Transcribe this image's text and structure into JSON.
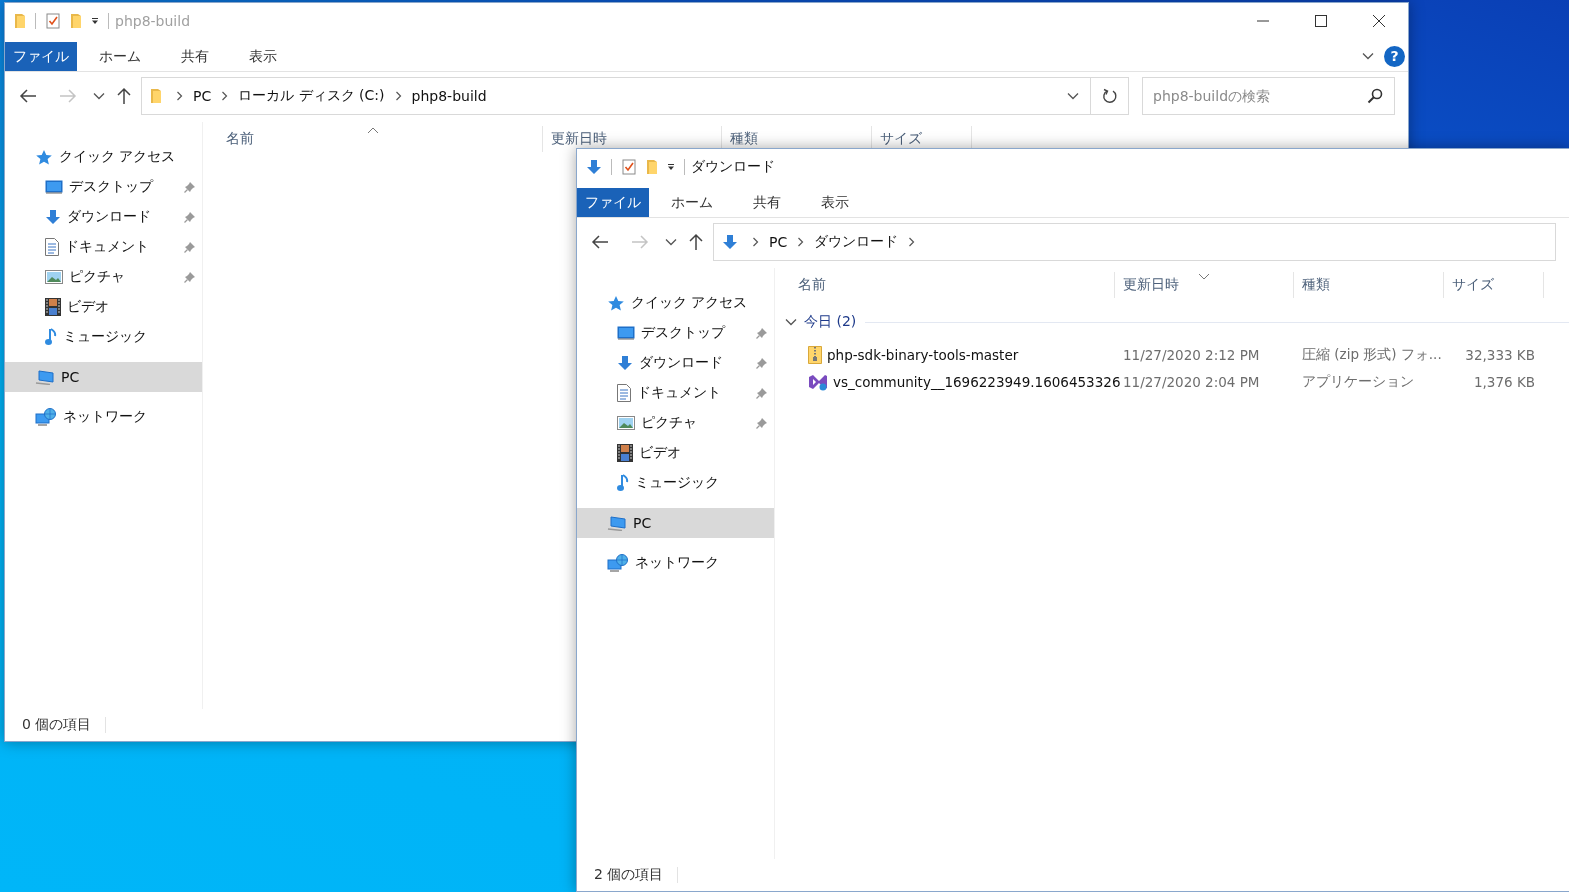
{
  "windows": [
    {
      "title": "php8-build",
      "active": false,
      "ribbon": {
        "tabs": [
          {
            "label": "ファイル",
            "selected": true
          },
          {
            "label": "ホーム",
            "selected": false
          },
          {
            "label": "共有",
            "selected": false
          },
          {
            "label": "表示",
            "selected": false
          }
        ],
        "help": "?"
      },
      "history": {
        "back_disabled": false,
        "forward_disabled": true
      },
      "address": {
        "crumbs": [
          "PC",
          "ローカル ディスク (C:)",
          "php8-build"
        ]
      },
      "search": {
        "placeholder": "php8-buildの検索"
      },
      "navigation": [
        {
          "label": "クイック アクセス",
          "selected": false,
          "children": [
            {
              "label": "デスクトップ",
              "pinned": true,
              "selected": false
            },
            {
              "label": "ダウンロード",
              "pinned": true,
              "selected": false
            },
            {
              "label": "ドキュメント",
              "pinned": true,
              "selected": false
            },
            {
              "label": "ピクチャ",
              "pinned": true,
              "selected": false
            },
            {
              "label": "ビデオ",
              "pinned": false,
              "selected": false
            },
            {
              "label": "ミュージック",
              "pinned": false,
              "selected": false
            }
          ]
        },
        {
          "label": "PC",
          "selected": true
        },
        {
          "label": "ネットワーク",
          "selected": false
        }
      ],
      "columns": [
        {
          "label": "名前",
          "sorted": true,
          "descending": false
        },
        {
          "label": "更新日時",
          "sorted": false
        },
        {
          "label": "種類",
          "sorted": false
        },
        {
          "label": "サイズ",
          "sorted": false
        }
      ],
      "status_bar": "0 個の項目"
    },
    {
      "title": "ダウンロード",
      "active": true,
      "ribbon": {
        "tabs": [
          {
            "label": "ファイル",
            "selected": true
          },
          {
            "label": "ホーム",
            "selected": false
          },
          {
            "label": "共有",
            "selected": false
          },
          {
            "label": "表示",
            "selected": false
          }
        ]
      },
      "history": {
        "back_disabled": false,
        "forward_disabled": true
      },
      "address": {
        "crumbs": [
          "PC",
          "ダウンロード"
        ]
      },
      "navigation": [
        {
          "label": "クイック アクセス",
          "selected": false,
          "children": [
            {
              "label": "デスクトップ",
              "pinned": true,
              "selected": false
            },
            {
              "label": "ダウンロード",
              "pinned": true,
              "selected": false
            },
            {
              "label": "ドキュメント",
              "pinned": true,
              "selected": false
            },
            {
              "label": "ピクチャ",
              "pinned": true,
              "selected": false
            },
            {
              "label": "ビデオ",
              "pinned": false,
              "selected": false
            },
            {
              "label": "ミュージック",
              "pinned": false,
              "selected": false
            }
          ]
        },
        {
          "label": "PC",
          "selected": true
        },
        {
          "label": "ネットワーク",
          "selected": false
        }
      ],
      "columns": [
        {
          "label": "名前",
          "sorted": false
        },
        {
          "label": "更新日時",
          "sorted": true,
          "descending": true
        },
        {
          "label": "種類",
          "sorted": false
        },
        {
          "label": "サイズ",
          "sorted": false
        }
      ],
      "groups": [
        {
          "label": "今日 (2)",
          "expanded": true,
          "rows": [
            {
              "name": "php-sdk-binary-tools-master",
              "date": "11/27/2020 2:12 PM",
              "type": "圧縮 (zip 形式) フォ...",
              "size": "32,333 KB"
            },
            {
              "name": "vs_community__1696223949.1606453326",
              "date": "11/27/2020 2:04 PM",
              "type": "アプリケーション",
              "size": "1,376 KB"
            }
          ]
        }
      ],
      "status_bar": "2 個の項目"
    }
  ]
}
